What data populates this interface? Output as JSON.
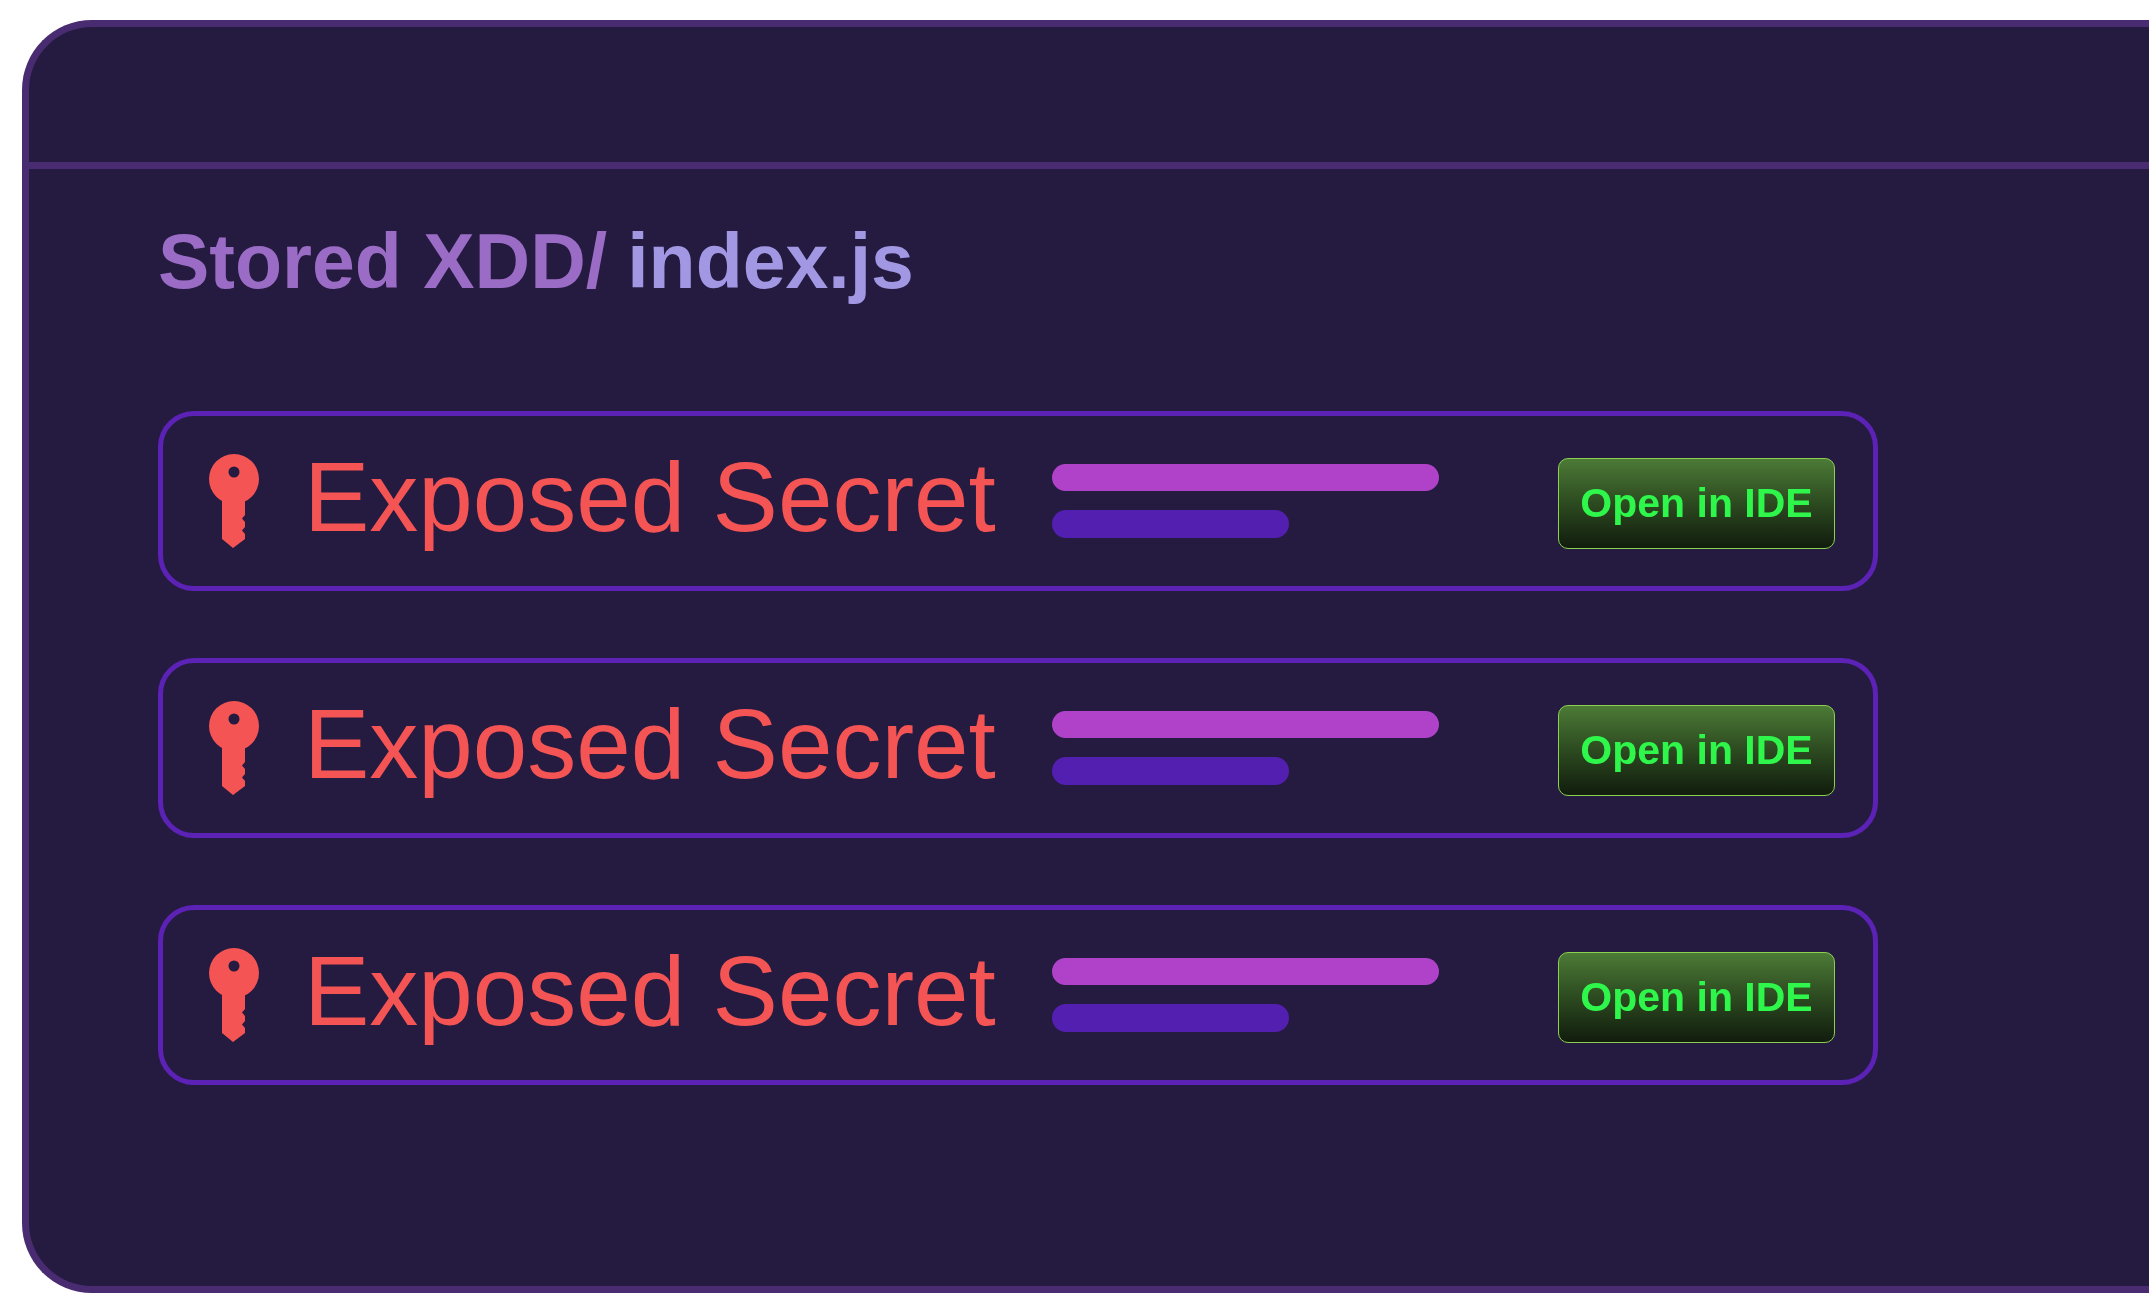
{
  "file_path": {
    "folder": "Stored XDD/",
    "file": "index.js"
  },
  "findings": [
    {
      "label": "Exposed Secret",
      "action": "Open in IDE"
    },
    {
      "label": "Exposed Secret",
      "action": "Open in IDE"
    },
    {
      "label": "Exposed Secret",
      "action": "Open in IDE"
    }
  ]
}
